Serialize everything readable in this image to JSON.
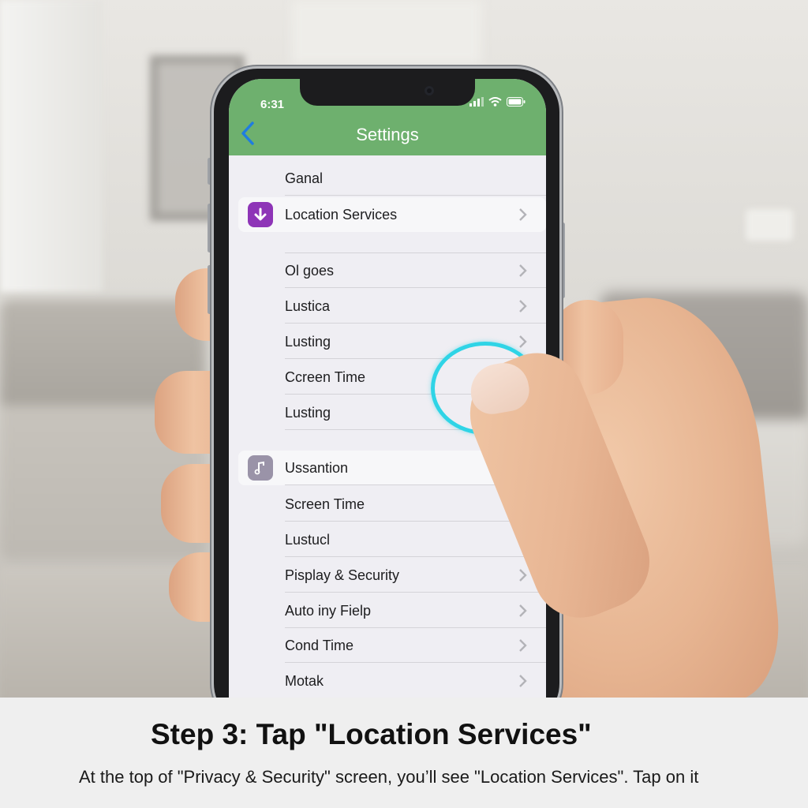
{
  "status_bar": {
    "time": "6:31"
  },
  "nav": {
    "title": "Settings"
  },
  "settings_list": [
    {
      "label": "Ganal",
      "chevron": false,
      "icon": null
    },
    {
      "label": "Location Services",
      "chevron": true,
      "icon": "download-arrow-icon",
      "icon_color": "#8e35b7"
    },
    {
      "label": "Ol goes",
      "chevron": true,
      "icon": null
    },
    {
      "label": "Lustica",
      "chevron": true,
      "icon": null
    },
    {
      "label": "Lusting",
      "chevron": true,
      "icon": null
    },
    {
      "label": "Ccreen Time",
      "chevron": true,
      "icon": null
    },
    {
      "label": "Lusting",
      "chevron": false,
      "icon": null
    },
    {
      "label": "Ussantion",
      "chevron": false,
      "icon": "music-note-icon",
      "icon_color": "#9a93a8"
    },
    {
      "label": "Screen Time",
      "chevron": true,
      "icon": null
    },
    {
      "label": "Lustucl",
      "chevron": true,
      "icon": null
    },
    {
      "label": "Pisplay & Security",
      "chevron": true,
      "icon": null
    },
    {
      "label": "Auto iny Fielp",
      "chevron": true,
      "icon": null
    },
    {
      "label": "Cond Time",
      "chevron": true,
      "icon": null
    },
    {
      "label": "Motak",
      "chevron": true,
      "icon": null
    }
  ],
  "caption": {
    "title": "Step 3: Tap \"Location Services\"",
    "body": "At the top of \"Privacy & Security\" screen, you’ll see \"Location Services\". Tap on it"
  },
  "colors": {
    "nav_bar": "#6eb06e",
    "tap_ring": "#2fd4e6",
    "back_chevron": "#1f7de0"
  }
}
